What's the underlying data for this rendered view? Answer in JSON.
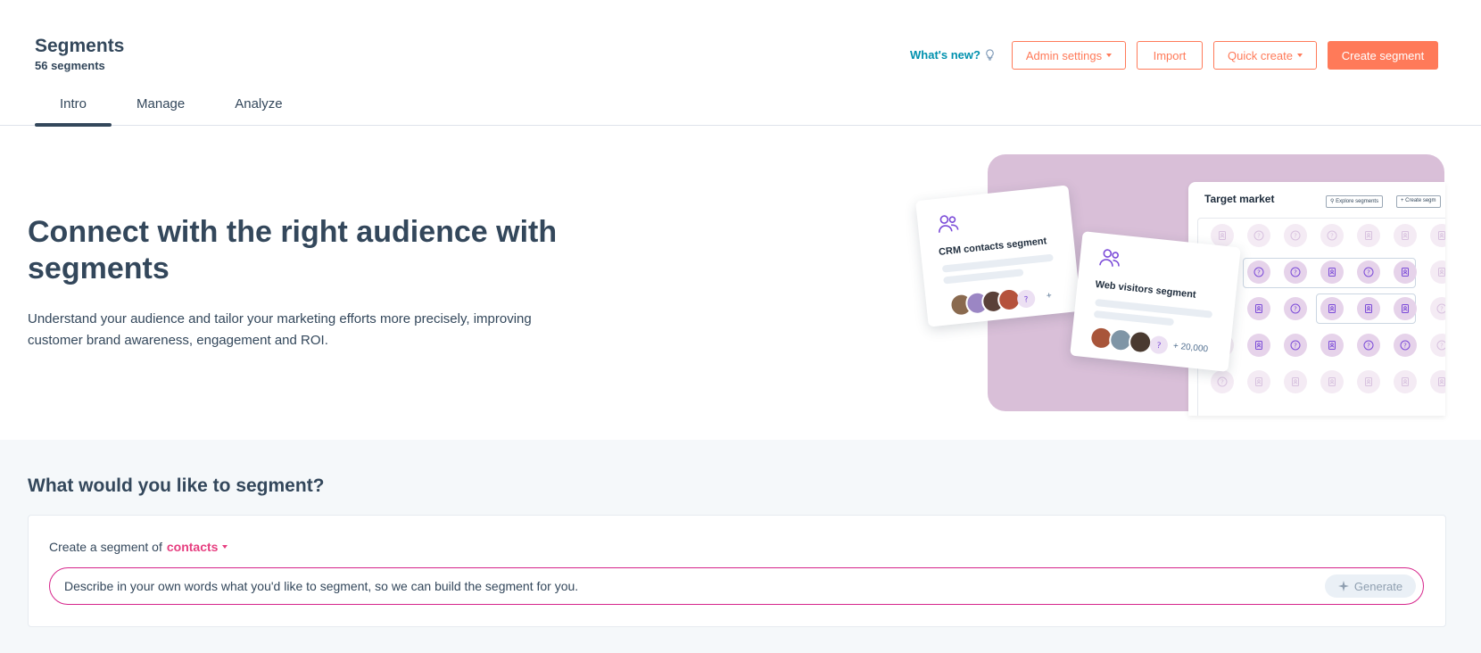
{
  "header": {
    "title": "Segments",
    "subtitle": "56 segments",
    "whats_new": "What's new?",
    "admin_settings": "Admin settings",
    "import": "Import",
    "quick_create": "Quick create",
    "create_segment": "Create segment"
  },
  "tabs": [
    {
      "label": "Intro",
      "active": true
    },
    {
      "label": "Manage",
      "active": false
    },
    {
      "label": "Analyze",
      "active": false
    }
  ],
  "hero": {
    "title": "Connect with the right audience with segments",
    "description": "Understand your audience and tailor your marketing efforts more precisely, improving customer brand awareness, engagement and ROI."
  },
  "illustration": {
    "target_market": "Target market",
    "explore_segments": "Explore segments",
    "create_segment": "Create segm",
    "crm_card_label": "CRM contacts segment",
    "crm_card_count": "+",
    "web_card_label": "Web visitors segment",
    "web_card_count": "+ 20,000"
  },
  "segment_section": {
    "title": "What would you like to segment?",
    "create_prefix": "Create a segment of",
    "object_selected": "contacts",
    "prompt_placeholder": "Describe in your own words what you'd like to segment, so we can build the segment for you.",
    "generate": "Generate"
  },
  "colors": {
    "accent": "#ff7a59",
    "text": "#33475b",
    "link": "#0091ae",
    "pink": "#e63d7f",
    "illustration_bg": "#d9bfd8"
  }
}
